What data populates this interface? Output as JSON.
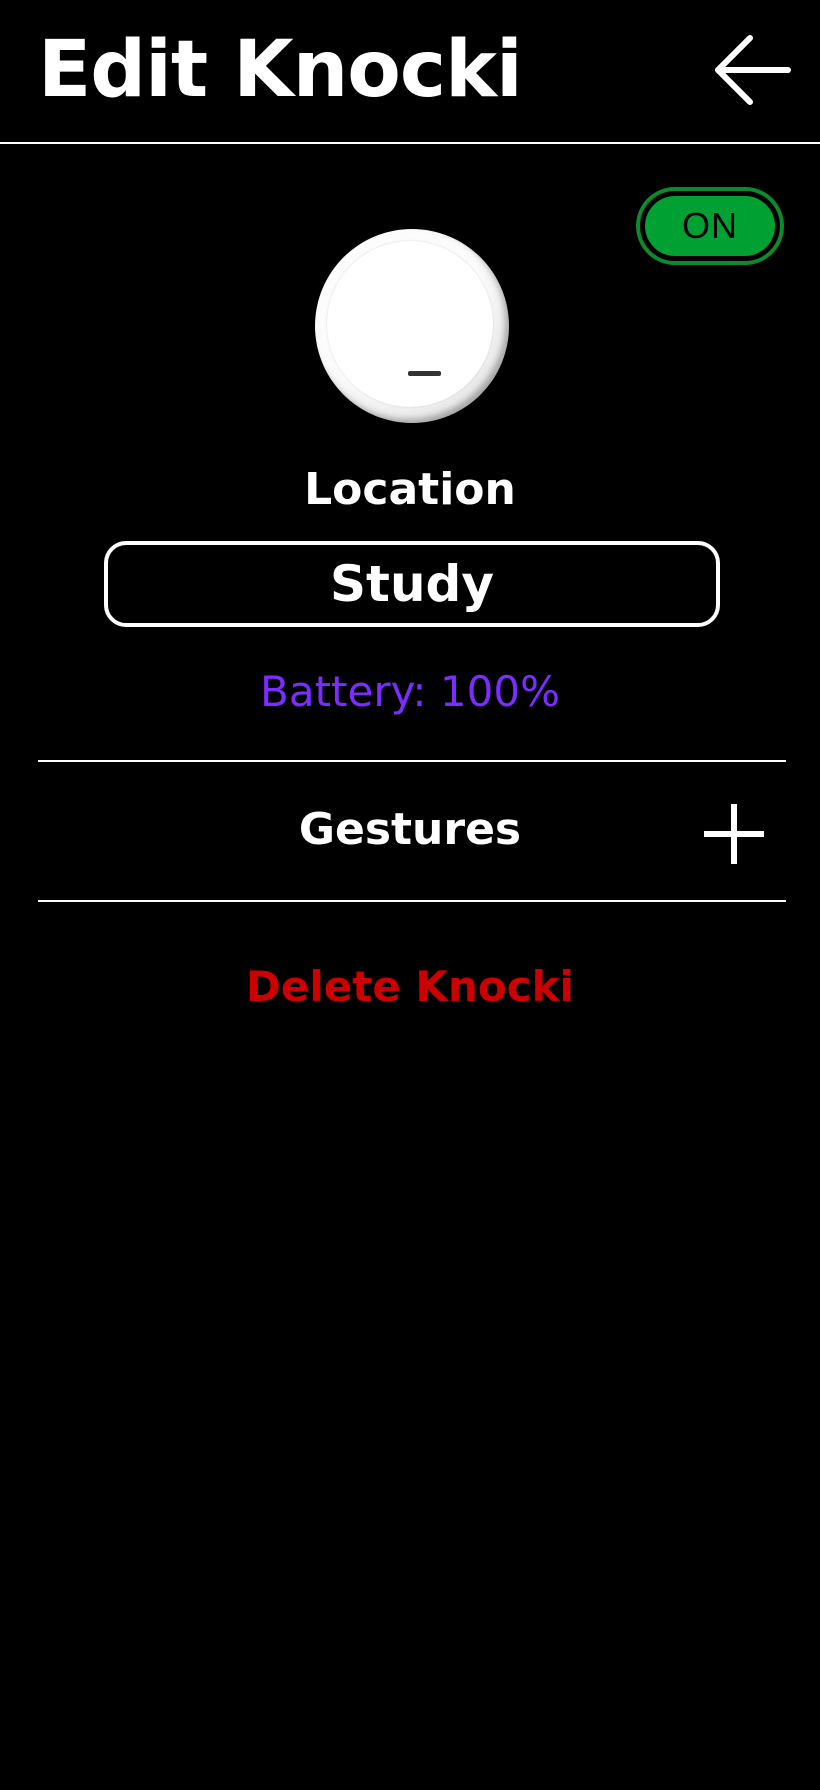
{
  "header": {
    "title": "Edit Knocki",
    "back_icon": "arrow-left-icon"
  },
  "toggle": {
    "label": "ON",
    "state": "on",
    "color": "#00a033"
  },
  "knob": {
    "icon": "knocki-device-icon"
  },
  "location": {
    "label": "Location",
    "value": "Study"
  },
  "battery": {
    "text": "Battery: 100%",
    "color": "#7b2cff"
  },
  "gestures": {
    "label": "Gestures",
    "add_icon": "plus-icon"
  },
  "delete": {
    "label": "Delete Knocki",
    "color": "#cc0000"
  }
}
